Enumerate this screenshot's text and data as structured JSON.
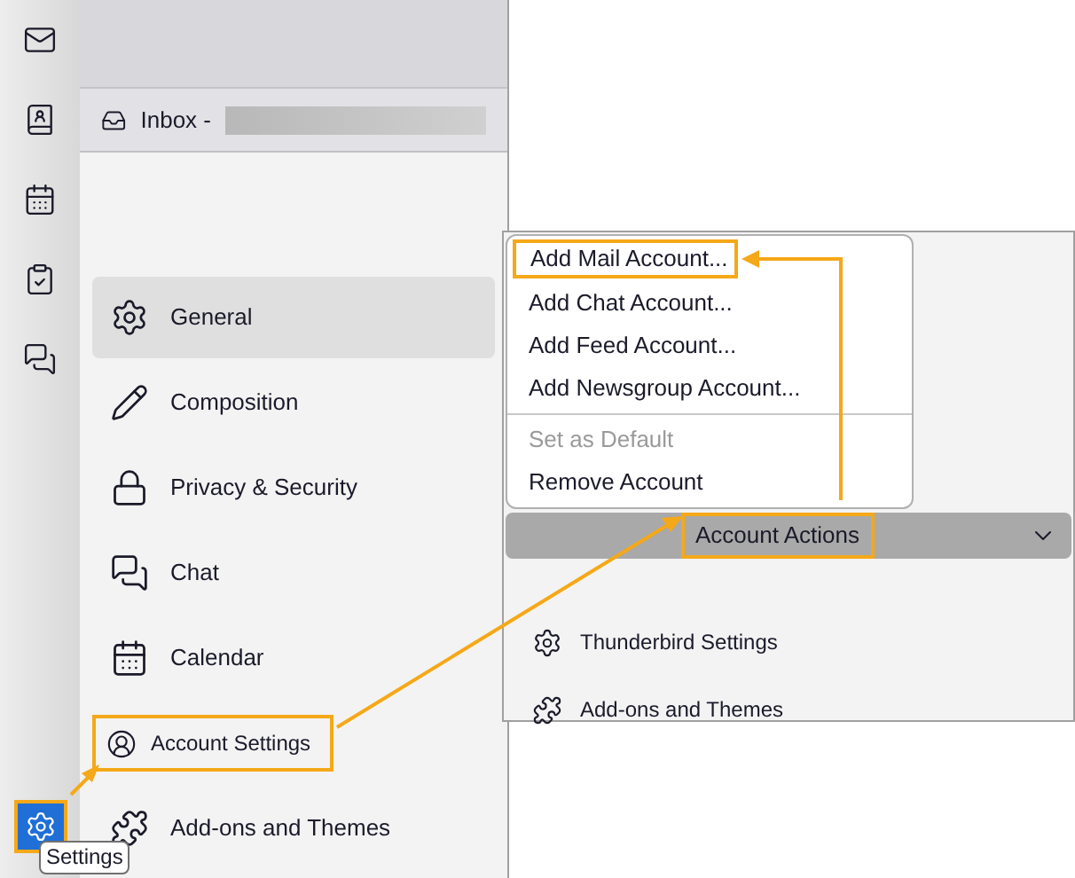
{
  "spaces_bar": {
    "items": [
      {
        "kind": "mail",
        "selected": false
      },
      {
        "kind": "address-book",
        "selected": false
      },
      {
        "kind": "calendar",
        "selected": false
      },
      {
        "kind": "tasks",
        "selected": false
      },
      {
        "kind": "chat",
        "selected": false
      }
    ],
    "settings_button": {
      "highlighted": true,
      "tooltip": "Settings"
    }
  },
  "tab": {
    "title": "Inbox -"
  },
  "settings_nav": {
    "items": [
      {
        "label": "General",
        "kind": "gear",
        "selected": true,
        "highlighted": false
      },
      {
        "label": "Composition",
        "kind": "pencil",
        "selected": false,
        "highlighted": false
      },
      {
        "label": "Privacy & Security",
        "kind": "lock",
        "selected": false,
        "highlighted": false
      },
      {
        "label": "Chat",
        "kind": "chat",
        "selected": false,
        "highlighted": false
      },
      {
        "label": "Calendar",
        "kind": "calendar",
        "selected": false,
        "highlighted": false
      },
      {
        "label": "Account Settings",
        "kind": "account",
        "selected": false,
        "highlighted": true
      },
      {
        "label": "Add-ons and Themes",
        "kind": "puzzle",
        "selected": false,
        "highlighted": false
      }
    ]
  },
  "account_actions_menu": {
    "items": [
      {
        "kind": "item",
        "label": "Add Mail Account...",
        "disabled": false,
        "highlighted": true
      },
      {
        "kind": "item",
        "label": "Add Chat Account...",
        "disabled": false,
        "highlighted": false
      },
      {
        "kind": "item",
        "label": "Add Feed Account...",
        "disabled": false,
        "highlighted": false
      },
      {
        "kind": "item",
        "label": "Add Newsgroup Account...",
        "disabled": false,
        "highlighted": false
      },
      {
        "kind": "separator"
      },
      {
        "kind": "item",
        "label": "Set as Default",
        "disabled": true,
        "highlighted": false
      },
      {
        "kind": "item",
        "label": "Remove Account",
        "disabled": false,
        "highlighted": false
      }
    ]
  },
  "account_actions_button": {
    "label": "Account Actions",
    "highlighted": true
  },
  "footer_links": [
    {
      "label": "Thunderbird Settings",
      "kind": "gear"
    },
    {
      "label": "Add-ons and Themes",
      "kind": "puzzle"
    }
  ]
}
